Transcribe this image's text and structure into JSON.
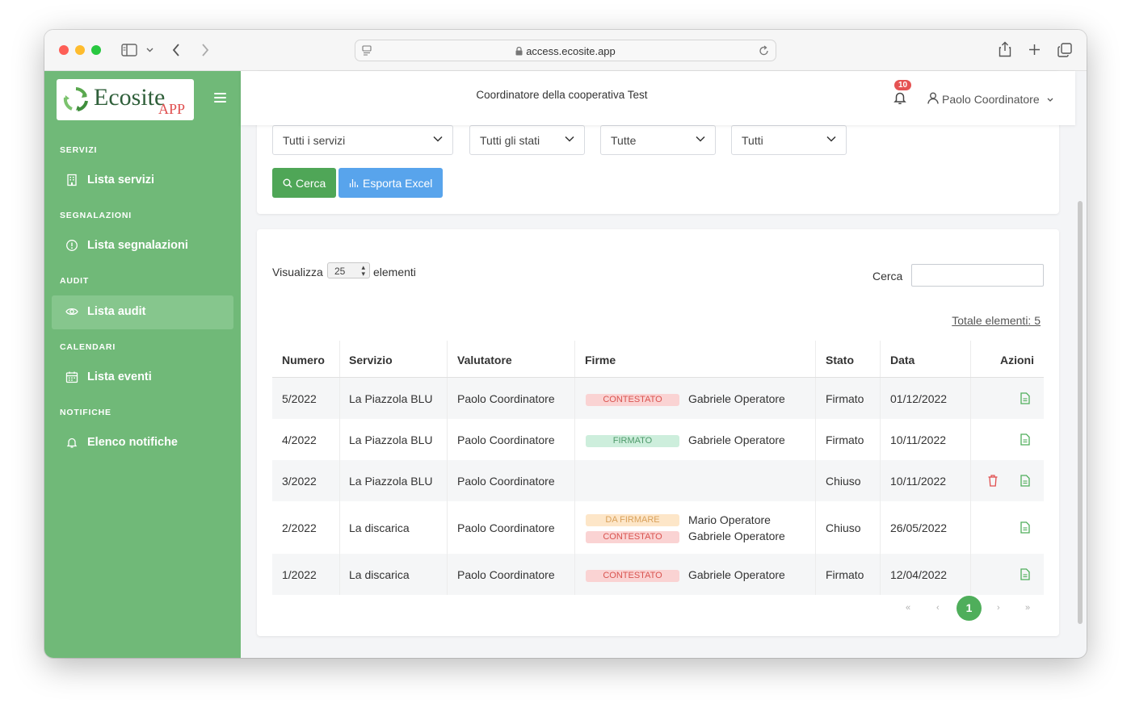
{
  "browser": {
    "url": "access.ecosite.app"
  },
  "sidebar": {
    "logo_main": "Ecosite",
    "logo_sub": "APP",
    "sections": [
      {
        "title": "SERVIZI",
        "item": "Lista servizi"
      },
      {
        "title": "SEGNALAZIONI",
        "item": "Lista segnalazioni"
      },
      {
        "title": "AUDIT",
        "item": "Lista audit"
      },
      {
        "title": "CALENDARI",
        "item": "Lista eventi"
      },
      {
        "title": "NOTIFICHE",
        "item": "Elenco notifiche"
      }
    ],
    "active_item": "Lista audit",
    "color": "#70b978"
  },
  "header": {
    "title": "Coordinatore della cooperativa Test",
    "notifications_count": "10",
    "user_name": "Paolo Coordinatore"
  },
  "filters": {
    "servizio": "Tutti i servizi",
    "stato": "Tutti gli stati",
    "firme": "Tutte",
    "altro": "Tutti",
    "search_button": "Cerca",
    "export_button": "Esporta Excel"
  },
  "table_controls": {
    "length_prefix": "Visualizza",
    "length_value": "25",
    "length_suffix": "elementi",
    "search_label": "Cerca",
    "search_value": "",
    "total": "Totale elementi: 5"
  },
  "table": {
    "columns": [
      "Numero",
      "Servizio",
      "Valutatore",
      "Firme",
      "Stato",
      "Data",
      "Azioni"
    ],
    "rows": [
      {
        "numero": "5/2022",
        "servizio": "La Piazzola BLU",
        "valutatore": "Paolo Coordinatore",
        "firme": [
          {
            "status": "CONTESTATO",
            "name": "Gabriele Operatore"
          }
        ],
        "stato": "Firmato",
        "data": "01/12/2022",
        "can_delete": false
      },
      {
        "numero": "4/2022",
        "servizio": "La Piazzola BLU",
        "valutatore": "Paolo Coordinatore",
        "firme": [
          {
            "status": "FIRMATO",
            "name": "Gabriele Operatore"
          }
        ],
        "stato": "Firmato",
        "data": "10/11/2022",
        "can_delete": false
      },
      {
        "numero": "3/2022",
        "servizio": "La Piazzola BLU",
        "valutatore": "Paolo Coordinatore",
        "firme": [],
        "stato": "Chiuso",
        "data": "10/11/2022",
        "can_delete": true
      },
      {
        "numero": "2/2022",
        "servizio": "La discarica",
        "valutatore": "Paolo Coordinatore",
        "firme": [
          {
            "status": "DA FIRMARE",
            "name": "Mario Operatore"
          },
          {
            "status": "CONTESTATO",
            "name": "Gabriele Operatore"
          }
        ],
        "stato": "Chiuso",
        "data": "26/05/2022",
        "can_delete": false
      },
      {
        "numero": "1/2022",
        "servizio": "La discarica",
        "valutatore": "Paolo Coordinatore",
        "firme": [
          {
            "status": "CONTESTATO",
            "name": "Gabriele Operatore"
          }
        ],
        "stato": "Firmato",
        "data": "12/04/2022",
        "can_delete": false
      }
    ]
  },
  "pagination": {
    "first": "«",
    "prev": "‹",
    "current": "1",
    "next": "›",
    "last": "»"
  }
}
